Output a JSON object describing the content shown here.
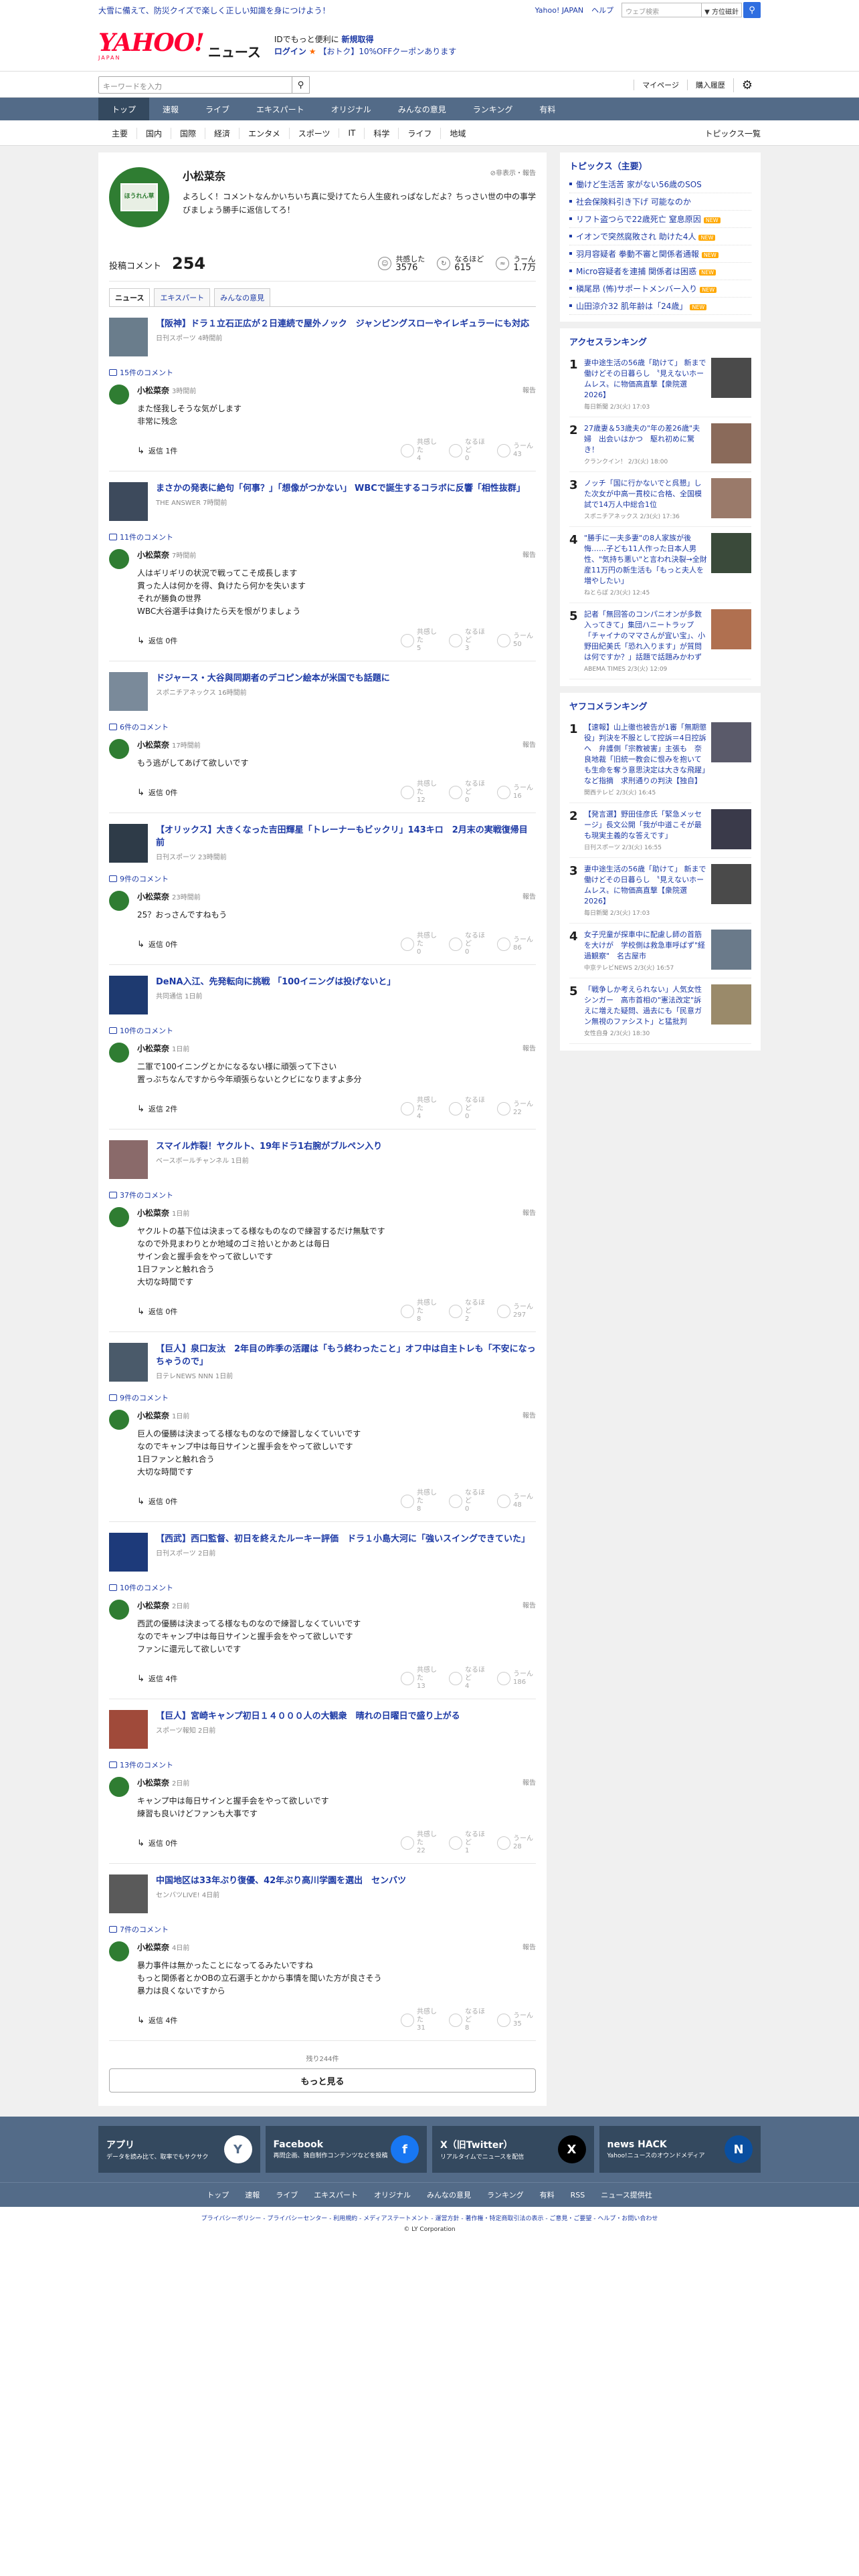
{
  "topbar": {
    "promo": "大雪に備えて、防災クイズで楽しく正しい知識を身につけよう！",
    "yahoo_japan": "Yahoo! JAPAN",
    "help": "ヘルプ",
    "web_search_placeholder": "ウェブ検索",
    "search_scope": "▼ 方位磁針"
  },
  "logo": {
    "main": "YAHOO!",
    "sub": "JAPAN",
    "news": "ニュース"
  },
  "logo_promo": {
    "line1a": "IDでもっと便利に",
    "line1b": "新規取得",
    "line2a": "ログイン",
    "line2b": "【おトク】10%OFFクーポンあります"
  },
  "search": {
    "placeholder": "キーワードを入力",
    "mypage": "マイページ",
    "history": "購入履歴"
  },
  "nav": [
    {
      "label": "トップ"
    },
    {
      "label": "速報"
    },
    {
      "label": "ライブ"
    },
    {
      "label": "エキスパート"
    },
    {
      "label": "オリジナル"
    },
    {
      "label": "みんなの意見"
    },
    {
      "label": "ランキング"
    },
    {
      "label": "有料"
    }
  ],
  "subnav": [
    {
      "label": "主要"
    },
    {
      "label": "国内"
    },
    {
      "label": "国際"
    },
    {
      "label": "経済"
    },
    {
      "label": "エンタメ"
    },
    {
      "label": "スポーツ"
    },
    {
      "label": "IT"
    },
    {
      "label": "科学"
    },
    {
      "label": "ライフ"
    },
    {
      "label": "地域"
    }
  ],
  "subnav_right": "トピックス一覧",
  "profile": {
    "name": "小松菜奈",
    "report": "非表示・報告",
    "avatar_text": "ほうれん草",
    "bio": "よろしく！コメントなんかいちいち真に受けてたら人生疲れっぱなしだよ？ちっさい世の中の事学びましょう勝手に返信してろ！",
    "posted_label": "投稿コメント",
    "posted_count": "254",
    "agree_label": "共感した",
    "agree_count": "3576",
    "insight_label": "なるほど",
    "insight_count": "615",
    "hmm_label": "うーん",
    "hmm_count": "1.7万"
  },
  "tabs": [
    {
      "label": "ニュース"
    },
    {
      "label": "エキスパート"
    },
    {
      "label": "みんなの意見"
    }
  ],
  "reply_label": "返信",
  "report_label": "報告",
  "react_agree": "共感した",
  "react_insight": "なるほど",
  "react_hmm": "うーん",
  "comments": [
    {
      "title": "【阪神】ドラ１立石正広が２日連続で屋外ノック　ジャンピングスローやイレギュラーにも対応",
      "source": "日刊スポーツ 4時間前",
      "count": "15件のコメント",
      "user": "小松菜奈",
      "time": "3時間前",
      "text": "また怪我しそうな気がします\n非常に残念",
      "replies": "返信 1件",
      "agree": "4",
      "insight": "0",
      "hmm": "43",
      "thumb": "#6a7d8c"
    },
    {
      "title": "まさかの発表に絶句「何事？」「想像がつかない」 WBCで誕生するコラボに反響「相性抜群」",
      "source": "THE ANSWER 7時間前",
      "count": "11件のコメント",
      "user": "小松菜奈",
      "time": "7時間前",
      "text": "人はギリギリの状況で戦ってこそ成長します\n貫った人は何かを得、負けたら何かを失います\nそれが勝負の世界\nWBC大谷選手は負けたら天を恨がりましょう",
      "replies": "返信 0件",
      "agree": "5",
      "insight": "3",
      "hmm": "50",
      "thumb": "#3d4a5c"
    },
    {
      "title": "ドジャース・大谷與同期者のデコピン絵本が米国でも話題に",
      "source": "スポニチアネックス 16時間前",
      "count": "6件のコメント",
      "user": "小松菜奈",
      "time": "17時間前",
      "text": "もう逃がしてあげて欲しいです",
      "replies": "返信 0件",
      "agree": "12",
      "insight": "0",
      "hmm": "16",
      "thumb": "#7a8a9a"
    },
    {
      "title": "【オリックス】大きくなった吉田輝星「トレーナーもビックリ」143キロ　2月末の実戦復帰目前",
      "source": "日刊スポーツ 23時間前",
      "count": "9件のコメント",
      "user": "小松菜奈",
      "time": "23時間前",
      "text": "25？おっさんですねもう",
      "replies": "返信 0件",
      "agree": "0",
      "insight": "0",
      "hmm": "86",
      "thumb": "#2e3b48"
    },
    {
      "title": "DeNA入江、先発転向に挑戦 「100イニングは投げないと」",
      "source": "共同通信 1日前",
      "count": "10件のコメント",
      "user": "小松菜奈",
      "time": "1日前",
      "text": "二軍で100イニングとかになるない様に頑張って下さい\n置っぷちなんですから今年頑張らないとクビになりますよ多分",
      "replies": "返信 2件",
      "agree": "4",
      "insight": "0",
      "hmm": "22",
      "thumb": "#1e3a70"
    },
    {
      "title": "スマイル炸裂！ヤクルト、19年ドラ1右腕がブルペン入り",
      "source": "ベースボールチャンネル 1日前",
      "count": "37件のコメント",
      "user": "小松菜奈",
      "time": "1日前",
      "text": "ヤクルトの基下位は決まってる様なものなので練習するだけ無駄です\nなので外見まわりとか地域のゴミ拾いとかあとは毎日\nサイン会と握手会をやって欲しいです\n1日ファンと触れ合う\n大切な時間です",
      "replies": "返信 0件",
      "agree": "8",
      "insight": "2",
      "hmm": "297",
      "thumb": "#8a6a6a"
    },
    {
      "title": "【巨人】泉口友汰　2年目の昨季の活躍は「もう終わったこと」オフ中は自主トレも「不安になっちゃうので」",
      "source": "日テレNEWS NNN 1日前",
      "count": "9件のコメント",
      "user": "小松菜奈",
      "time": "1日前",
      "text": "巨人の優勝は決まってる様なものなので練習しなくていいです\nなのでキャンプ中は毎日サインと握手会をやって欲しいです\n1日ファンと触れ合う\n大切な時間です",
      "replies": "返信 0件",
      "agree": "8",
      "insight": "0",
      "hmm": "48",
      "thumb": "#4a5a6a"
    },
    {
      "title": "【西武】西口監督、初日を終えたルーキー評価　ドラ１小島大河に「強いスイングできていた」",
      "source": "日刊スポーツ 2日前",
      "count": "10件のコメント",
      "user": "小松菜奈",
      "time": "2日前",
      "text": "西武の優勝は決まってる様なものなので練習しなくていいです\nなのでキャンプ中は毎日サインと握手会をやって欲しいです\nファンに還元して欲しいです",
      "replies": "返信 4件",
      "agree": "13",
      "insight": "4",
      "hmm": "186",
      "thumb": "#1d3a7a"
    },
    {
      "title": "【巨人】宮崎キャンプ初日１４０００人の大観衆　晴れの日曜日で盛り上がる",
      "source": "スポーツ報知 2日前",
      "count": "13件のコメント",
      "user": "小松菜奈",
      "time": "2日前",
      "text": "キャンプ中は毎日サインと握手会をやって欲しいです\n練習も良いけどファンも大事です",
      "replies": "返信 0件",
      "agree": "22",
      "insight": "1",
      "hmm": "28",
      "thumb": "#a04a3a"
    },
    {
      "title": "中国地区は33年ぶり復優、42年ぶり高川学園を選出　センバツ",
      "source": "センバツLIVE! 4日前",
      "count": "7件のコメント",
      "user": "小松菜奈",
      "time": "4日前",
      "text": "暴力事件は無かったことになってるみたいですね\nもっと関係者とかOBの立石選手とかから事情を聞いた方が良さそう\n暴力は良くないですから",
      "replies": "返信 4件",
      "agree": "31",
      "insight": "8",
      "hmm": "35",
      "thumb": "#5a5a5a"
    }
  ],
  "more": {
    "remaining": "残り244件",
    "button": "もっと見る"
  },
  "topics": {
    "title": "トピックス（主要）",
    "items": [
      {
        "text": "働けど生活苦 家がない56歳のSOS",
        "new": ""
      },
      {
        "text": "社会保険料引き下げ 可能なのか",
        "new": ""
      },
      {
        "text": "リフト盗つらで22歳死亡 窒息原因",
        "new": "NEW"
      },
      {
        "text": "イオンで突然腐敗され 助けた4人",
        "new": "NEW"
      },
      {
        "text": "羽月容疑者 拳動不審と関係者通報",
        "new": "NEW"
      },
      {
        "text": "Micro容疑者を連捕 関係者は困惑",
        "new": "NEW"
      },
      {
        "text": "槇尾昂 (怖)サポートメンバー入り",
        "new": "NEW"
      },
      {
        "text": "山田涼介32 肌年齢は「24歳」",
        "new": "NEW"
      }
    ]
  },
  "access_ranking": {
    "title": "アクセスランキング",
    "items": [
      {
        "title": "妻中途生活の56歳「助けて」 新まで働けどその日暮らし 〝見えないホームレス〟に物価高直撃【衆院選2026】",
        "source": "毎日新聞 2/3(火) 17:03",
        "thumb": "#4a4a4a"
      },
      {
        "title": "27歳妻＆53歳夫の\"年の差26歳\"夫婦　出会いはかつ　駆れ初めに驚き！",
        "source": "クランクイン！ 2/3(火) 18:00",
        "thumb": "#8a6a5a"
      },
      {
        "title": "ノッチ「国に行かないでと呉懇」した次女が中高一貫校に合格、全国模試で14万人中総合1位",
        "source": "スポニチアネックス 2/3(火) 17:36",
        "thumb": "#9a7a6a"
      },
      {
        "title": "\"勝手に一夫多妻\"の8人家族が後悔……子ども11人作った日本人男性、\"気持ち悪い\"と言われ決裂→全財産11万円の新生活も「もっと夫人を増やしたい」",
        "source": "ねとらぼ 2/3(火) 12:45",
        "thumb": "#3a4a3a"
      },
      {
        "title": "記者「無回答のコンパニオンが多数入ってきて」集団ハニートラップ「チャイナのママさんが宜い宝」、小野田紀美氏「恐れ入ります」が質問は何ですか？」話題で話題みかわず",
        "source": "ABEMA TIMES 2/3(火) 12:09",
        "thumb": "#b07050"
      }
    ]
  },
  "yahoo_ranking": {
    "title": "ヤフコメランキング",
    "items": [
      {
        "title": "【速報】山上徹也被告が1審「無期懲役」判決を不服として控訴＝4日控訴へ　弁護側「宗教被害」主張も　奈良地裁「旧統一教会に恨みを抱いても生命を奪う意思決定は大きな飛躍」など指摘　求刑通りの判決【独自】",
        "source": "関西テレビ 2/3(火) 16:45",
        "thumb": "#5a5a6a"
      },
      {
        "title": "【発言選】野田佳彦氏「緊急メッセージ」長文公開「我が中道こそが最も現実主義的な答えです」",
        "source": "日刊スポーツ 2/3(火) 16:55",
        "thumb": "#3a3a4a"
      },
      {
        "title": "妻中途生活の56歳「助けて」 新まで働けどその日暮らし 〝見えないホームレス〟に物価高直撃【衆院選2026】",
        "source": "毎日新聞 2/3(火) 17:03",
        "thumb": "#4a4a4a"
      },
      {
        "title": "女子児童が探車中に配慮し師の首筋を大けが　学校側は救急車呼ばず\"経過観察\"　名古屋市",
        "source": "中京テレビNEWS 2/3(火) 16:57",
        "thumb": "#6a7a8a"
      },
      {
        "title": "「戦争しか考えられない」人気女性シンガー　高市首相の\"憲法改定\"訴えに増えた疑問、過去にも「民意ガン無視のファシスト」と猛批判",
        "source": "女性自身 2/3(火) 18:30",
        "thumb": "#9a8a6a"
      }
    ]
  },
  "footer_cards": [
    {
      "title": "アプリ",
      "desc": "データを読み比て、取率でもサクサク",
      "icon": "Y",
      "color": "#ffffff",
      "fg": "#536b88"
    },
    {
      "title": "Facebook",
      "desc": "再問企画、独自制作コンテンツなどを投稿",
      "icon": "f",
      "color": "#1877f2",
      "fg": "#ffffff"
    },
    {
      "title": "X（旧Twitter）",
      "desc": "リアルタイムでニュースを配信",
      "icon": "X",
      "color": "#000000",
      "fg": "#ffffff"
    },
    {
      "title": "news HACK",
      "desc": "Yahoo!ニュースのオウンドメディア",
      "icon": "N",
      "color": "#0a4fa0",
      "fg": "#ffffff"
    }
  ],
  "footer_nav": [
    {
      "label": "トップ"
    },
    {
      "label": "速報"
    },
    {
      "label": "ライブ"
    },
    {
      "label": "エキスパート"
    },
    {
      "label": "オリジナル"
    },
    {
      "label": "みんなの意見"
    },
    {
      "label": "ランキング"
    },
    {
      "label": "有料"
    },
    {
      "label": "RSS"
    },
    {
      "label": "ニュース提供社"
    }
  ],
  "legal": {
    "links": "プライバシーポリシー - プライバシーセンター - 利用規約 - メディアステートメント - 運営方針 - 著作権・特定商取引法の表示 - ご意見・ご要望 - ヘルプ・お問い合わせ",
    "copyright": "© LY Corporation"
  }
}
